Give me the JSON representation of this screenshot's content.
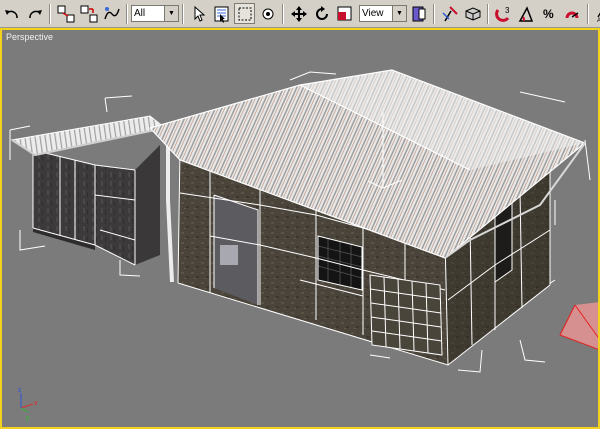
{
  "toolbar": {
    "selection_filter": "All",
    "reference_coord": "View",
    "snap_label": "3",
    "angle_snap_label": "",
    "percent_label": "%"
  },
  "viewport": {
    "label": "Perspective",
    "active_border_color": "#f2d21c",
    "background_color": "#7b7b7b"
  },
  "axis": {
    "x_label": "x",
    "y_label": "y",
    "z_label": "z"
  },
  "icons": [
    "undo-icon",
    "redo-icon",
    "select-link-icon",
    "unlink-icon",
    "bind-spacewarp-icon",
    "select-object-icon",
    "select-by-name-icon",
    "rect-selection-region-icon",
    "window-crossing-icon",
    "select-move-icon",
    "select-rotate-icon",
    "select-scale-icon",
    "pivot-center-icon",
    "manipulate-icon",
    "keyboard-shortcut-icon",
    "snaps-toggle-icon",
    "angle-snap-icon",
    "percent-snap-icon",
    "spinner-snap-icon",
    "named-selection-icon"
  ]
}
